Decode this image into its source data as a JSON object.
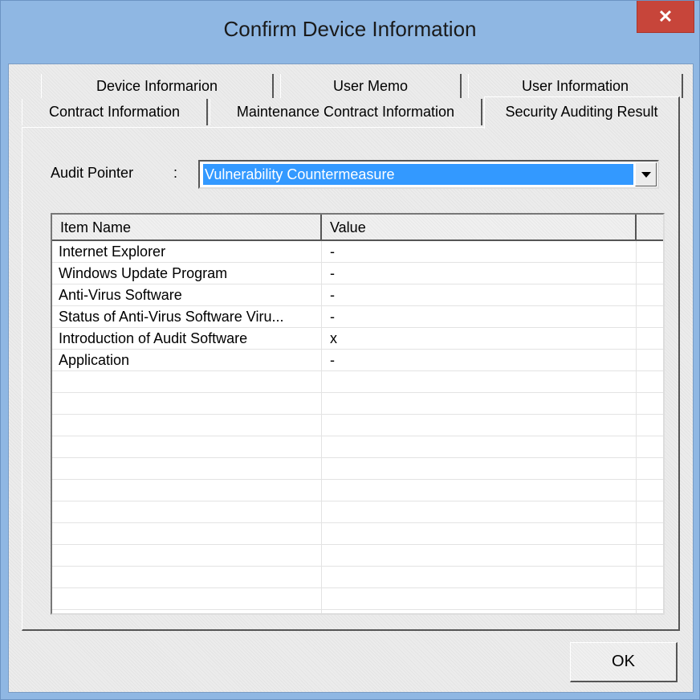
{
  "window": {
    "title": "Confirm Device Information",
    "close_glyph": "✕"
  },
  "tabs_row1": [
    "Device Informarion",
    "User Memo",
    "User Information"
  ],
  "tabs_row2": [
    "Contract Information",
    "Maintenance Contract Information",
    "Security Auditing Result"
  ],
  "active_tab": "Security Auditing Result",
  "audit": {
    "label": "Audit Pointer",
    "colon": ":",
    "selected": "Vulnerability Countermeasure"
  },
  "list": {
    "headers": [
      "Item Name",
      "Value"
    ],
    "rows": [
      {
        "name": "Internet Explorer",
        "value": "-"
      },
      {
        "name": "Windows Update Program",
        "value": "-"
      },
      {
        "name": "Anti-Virus Software",
        "value": "-"
      },
      {
        "name": "Status of Anti-Virus Software Viru...",
        "value": "-"
      },
      {
        "name": "Introduction of Audit Software",
        "value": "x"
      },
      {
        "name": "Application",
        "value": "-"
      }
    ]
  },
  "buttons": {
    "ok": "OK"
  },
  "colors": {
    "frame": "#8fb7e3",
    "close": "#c7453a",
    "selection": "#3399ff"
  }
}
